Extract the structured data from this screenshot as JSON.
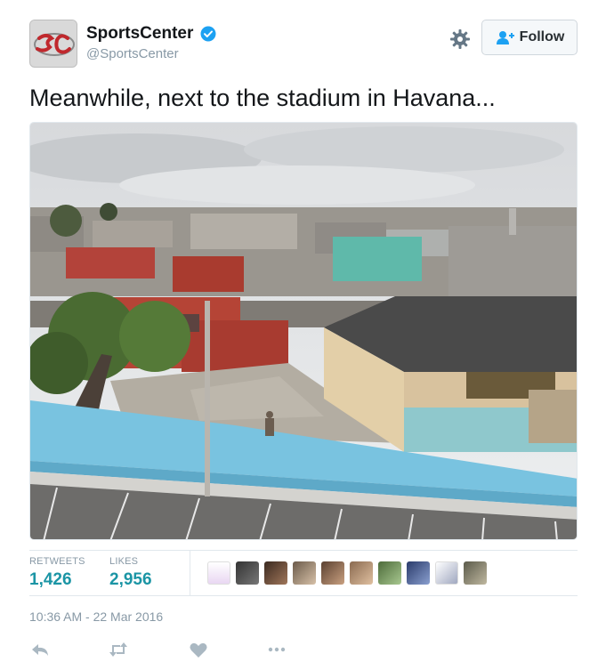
{
  "tweet": {
    "display_name": "SportsCenter",
    "handle": "@SportsCenter",
    "text": "Meanwhile, next to the stadium in Havana...",
    "timestamp": "10:36 AM - 22 Mar 2016"
  },
  "header": {
    "follow_label": "Follow"
  },
  "stats": {
    "retweets_label": "RETWEETS",
    "retweets_value": "1,426",
    "likes_label": "LIKES",
    "likes_value": "2,956"
  },
  "colors": {
    "accent": "#1b95a5",
    "verified": "#1da1f2",
    "muted": "#8899a6"
  },
  "icons": [
    "verified-badge-icon",
    "gear-icon",
    "follow-person-icon",
    "reply-icon",
    "retweet-icon",
    "like-icon",
    "more-icon"
  ]
}
